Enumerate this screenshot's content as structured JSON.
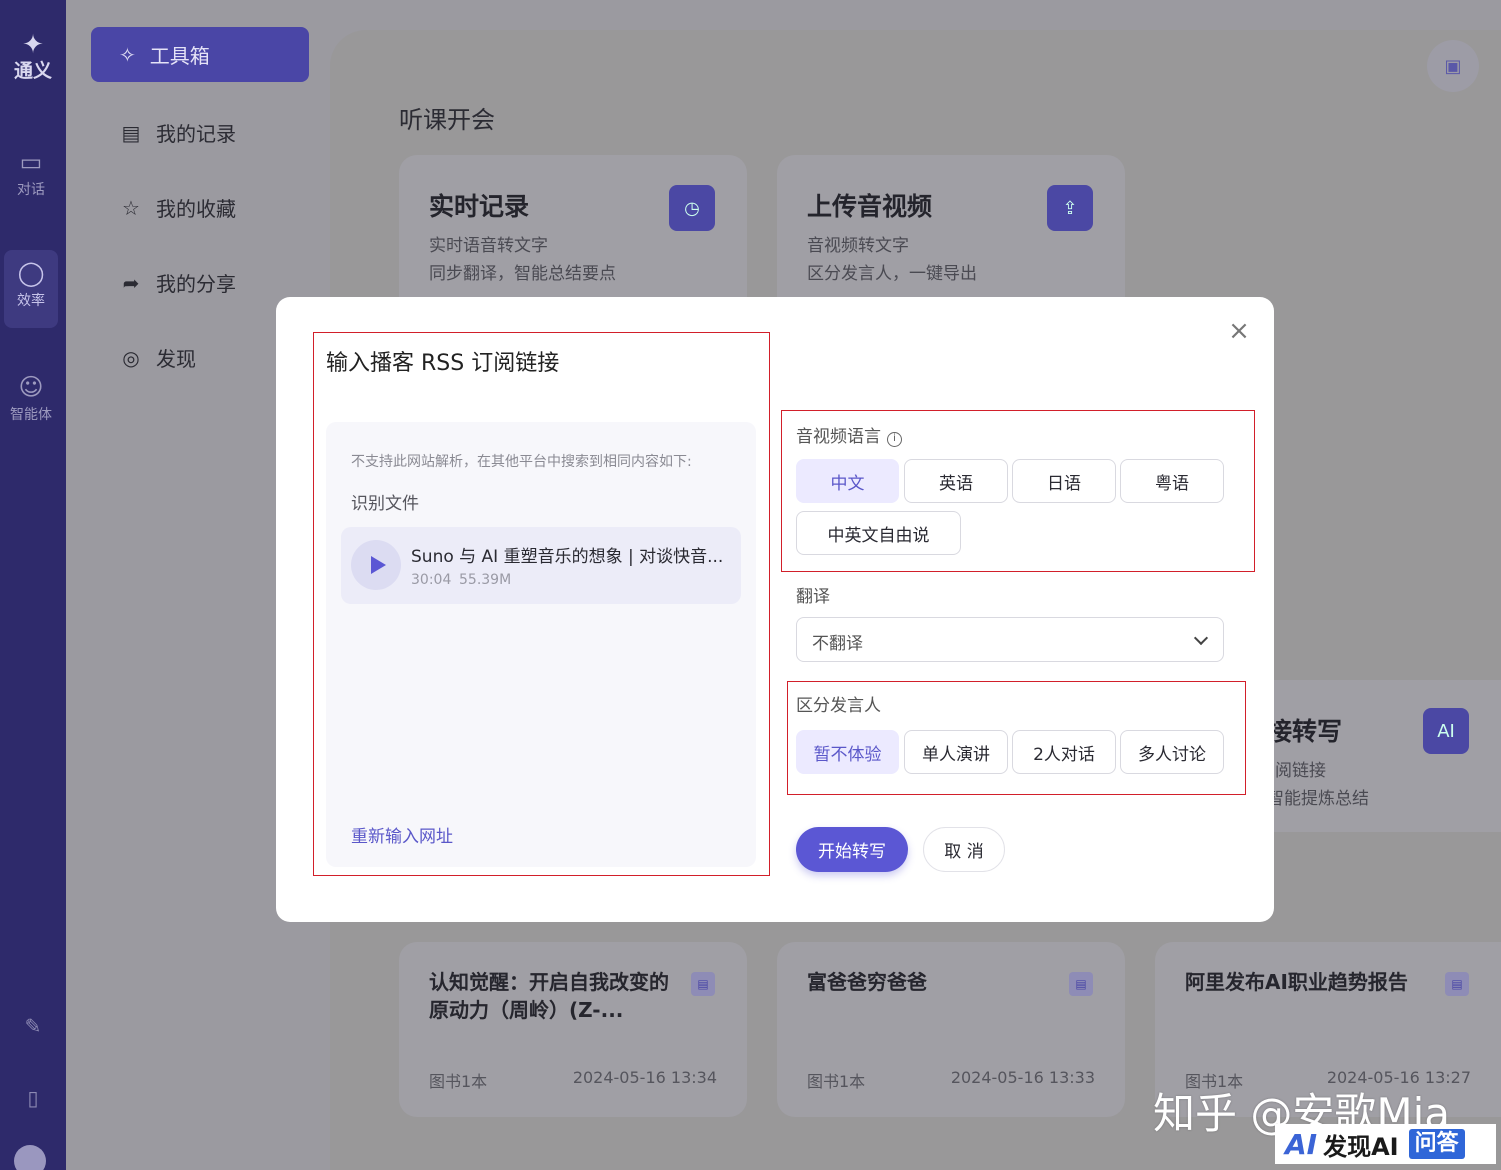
{
  "rail": {
    "logo_text": "通义",
    "items": [
      {
        "label": "对话",
        "icon": "chat-icon"
      },
      {
        "label": "效率",
        "icon": "bulb-icon"
      },
      {
        "label": "智能体",
        "icon": "agent-icon"
      }
    ]
  },
  "nav": {
    "primary": {
      "label": "工具箱",
      "icon": "magic-icon"
    },
    "items": [
      {
        "label": "我的记录",
        "icon": "record-icon"
      },
      {
        "label": "我的收藏",
        "icon": "star-icon"
      },
      {
        "label": "我的分享",
        "icon": "share-icon"
      },
      {
        "label": "发现",
        "icon": "compass-icon"
      }
    ]
  },
  "main": {
    "section_title": "听课开会",
    "cards": [
      {
        "title": "实时记录",
        "line1": "实时语音转文字",
        "line2": "同步翻译，智能总结要点"
      },
      {
        "title": "上传音视频",
        "line1": "音视频转文字",
        "line2": "区分发言人，一键导出"
      },
      {
        "title": "接转写",
        "line1": "阅链接",
        "line2": "智能提炼总结"
      }
    ],
    "records": [
      {
        "title": "认知觉醒：开启自我改变的原动力（周岭）(Z-...",
        "meta": "图书1本",
        "date": "2024-05-16 13:34"
      },
      {
        "title": "富爸爸穷爸爸",
        "meta": "图书1本",
        "date": "2024-05-16 13:33"
      },
      {
        "title": "阿里发布AI职业趋势报告",
        "meta": "图书1本",
        "date": "2024-05-16 13:27"
      }
    ]
  },
  "modal": {
    "title": "输入播客 RSS 订阅链接",
    "note": "不支持此网站解析，在其他平台中搜索到相同内容如下:",
    "subtitle": "识别文件",
    "file": {
      "name": "Suno 与 AI 重塑音乐的想象 | 对谈快音...",
      "duration": "30:04",
      "size": "55.39M"
    },
    "reinput": "重新输入网址",
    "language": {
      "label": "音视频语言",
      "options": [
        "中文",
        "英语",
        "日语",
        "粤语",
        "中英文自由说"
      ],
      "selected": "中文"
    },
    "translate": {
      "label": "翻译",
      "value": "不翻译"
    },
    "speakers": {
      "label": "区分发言人",
      "options": [
        "暂不体验",
        "单人演讲",
        "2人对话",
        "多人讨论"
      ],
      "selected": "暂不体验"
    },
    "start_button": "开始转写",
    "cancel_button": "取 消"
  },
  "watermark": {
    "text": "知乎 @安歌Mia",
    "badge_ai": "AI",
    "badge_text": "发现AI",
    "badge_qa": "问答"
  },
  "colors": {
    "accent": "#5b57d4",
    "highlight_box": "#d21f2a",
    "rail": "#2e2a6b"
  }
}
